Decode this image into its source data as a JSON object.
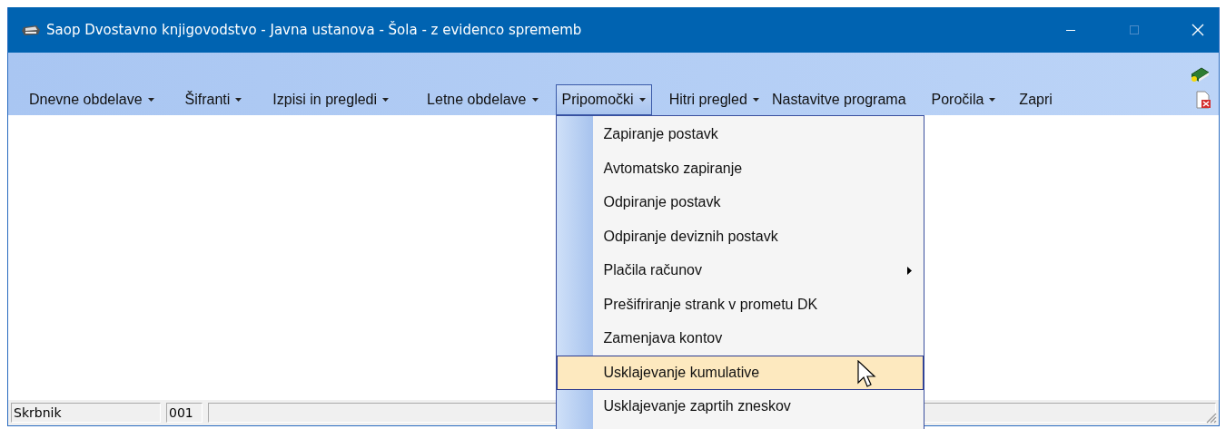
{
  "window": {
    "title": "Saop Dvostavno knjigovodstvo - Javna ustanova - Šola - z evidenco sprememb",
    "maximize_disabled": true
  },
  "menu_bar": [
    {
      "label": "Dnevne obdelave",
      "dropdown": true,
      "selected": false
    },
    {
      "label": "Šifranti",
      "dropdown": true,
      "selected": false
    },
    {
      "label": "Izpisi in pregledi",
      "dropdown": true,
      "selected": false
    },
    {
      "label": "Letne obdelave",
      "dropdown": true,
      "selected": false
    },
    {
      "label": "Pripomočki",
      "dropdown": true,
      "selected": true
    },
    {
      "label": "Hitri pregled",
      "dropdown": true,
      "selected": false
    },
    {
      "label": "Nastavitve programa",
      "dropdown": false,
      "selected": false
    },
    {
      "label": "Poročila",
      "dropdown": true,
      "selected": false
    },
    {
      "label": "Zapri",
      "dropdown": false,
      "selected": false
    }
  ],
  "dropdown_menu": [
    {
      "label": "Zapiranje postavk",
      "submenu": false,
      "selected": false
    },
    {
      "label": "Avtomatsko zapiranje",
      "submenu": false,
      "selected": false
    },
    {
      "label": "Odpiranje postavk",
      "submenu": false,
      "selected": false
    },
    {
      "label": "Odpiranje deviznih postavk",
      "submenu": false,
      "selected": false
    },
    {
      "label": "Plačila računov",
      "submenu": true,
      "selected": false
    },
    {
      "label": "Prešifriranje strank v prometu DK",
      "submenu": false,
      "selected": false
    },
    {
      "label": "Zamenjava kontov",
      "submenu": false,
      "selected": false
    },
    {
      "label": "Usklajevanje kumulative",
      "submenu": false,
      "selected": true
    },
    {
      "label": "Usklajevanje zaprtih zneskov",
      "submenu": false,
      "selected": false
    }
  ],
  "status_bar": [
    "Skrbnik",
    "001"
  ]
}
